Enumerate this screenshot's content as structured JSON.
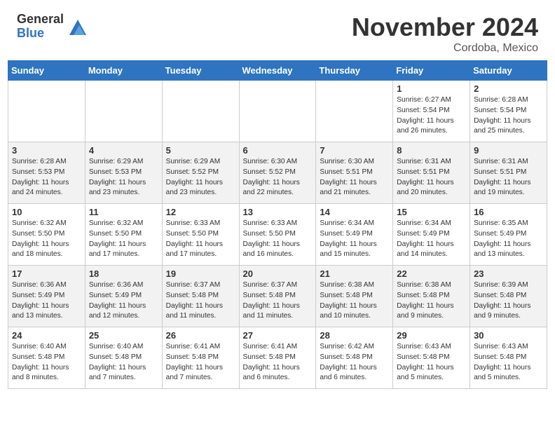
{
  "header": {
    "logo_general": "General",
    "logo_blue": "Blue",
    "month_title": "November 2024",
    "location": "Cordoba, Mexico"
  },
  "days_of_week": [
    "Sunday",
    "Monday",
    "Tuesday",
    "Wednesday",
    "Thursday",
    "Friday",
    "Saturday"
  ],
  "weeks": [
    [
      {
        "day": "",
        "info": ""
      },
      {
        "day": "",
        "info": ""
      },
      {
        "day": "",
        "info": ""
      },
      {
        "day": "",
        "info": ""
      },
      {
        "day": "",
        "info": ""
      },
      {
        "day": "1",
        "info": "Sunrise: 6:27 AM\nSunset: 5:54 PM\nDaylight: 11 hours and 26 minutes."
      },
      {
        "day": "2",
        "info": "Sunrise: 6:28 AM\nSunset: 5:54 PM\nDaylight: 11 hours and 25 minutes."
      }
    ],
    [
      {
        "day": "3",
        "info": "Sunrise: 6:28 AM\nSunset: 5:53 PM\nDaylight: 11 hours and 24 minutes."
      },
      {
        "day": "4",
        "info": "Sunrise: 6:29 AM\nSunset: 5:53 PM\nDaylight: 11 hours and 23 minutes."
      },
      {
        "day": "5",
        "info": "Sunrise: 6:29 AM\nSunset: 5:52 PM\nDaylight: 11 hours and 23 minutes."
      },
      {
        "day": "6",
        "info": "Sunrise: 6:30 AM\nSunset: 5:52 PM\nDaylight: 11 hours and 22 minutes."
      },
      {
        "day": "7",
        "info": "Sunrise: 6:30 AM\nSunset: 5:51 PM\nDaylight: 11 hours and 21 minutes."
      },
      {
        "day": "8",
        "info": "Sunrise: 6:31 AM\nSunset: 5:51 PM\nDaylight: 11 hours and 20 minutes."
      },
      {
        "day": "9",
        "info": "Sunrise: 6:31 AM\nSunset: 5:51 PM\nDaylight: 11 hours and 19 minutes."
      }
    ],
    [
      {
        "day": "10",
        "info": "Sunrise: 6:32 AM\nSunset: 5:50 PM\nDaylight: 11 hours and 18 minutes."
      },
      {
        "day": "11",
        "info": "Sunrise: 6:32 AM\nSunset: 5:50 PM\nDaylight: 11 hours and 17 minutes."
      },
      {
        "day": "12",
        "info": "Sunrise: 6:33 AM\nSunset: 5:50 PM\nDaylight: 11 hours and 17 minutes."
      },
      {
        "day": "13",
        "info": "Sunrise: 6:33 AM\nSunset: 5:50 PM\nDaylight: 11 hours and 16 minutes."
      },
      {
        "day": "14",
        "info": "Sunrise: 6:34 AM\nSunset: 5:49 PM\nDaylight: 11 hours and 15 minutes."
      },
      {
        "day": "15",
        "info": "Sunrise: 6:34 AM\nSunset: 5:49 PM\nDaylight: 11 hours and 14 minutes."
      },
      {
        "day": "16",
        "info": "Sunrise: 6:35 AM\nSunset: 5:49 PM\nDaylight: 11 hours and 13 minutes."
      }
    ],
    [
      {
        "day": "17",
        "info": "Sunrise: 6:36 AM\nSunset: 5:49 PM\nDaylight: 11 hours and 13 minutes."
      },
      {
        "day": "18",
        "info": "Sunrise: 6:36 AM\nSunset: 5:49 PM\nDaylight: 11 hours and 12 minutes."
      },
      {
        "day": "19",
        "info": "Sunrise: 6:37 AM\nSunset: 5:48 PM\nDaylight: 11 hours and 11 minutes."
      },
      {
        "day": "20",
        "info": "Sunrise: 6:37 AM\nSunset: 5:48 PM\nDaylight: 11 hours and 11 minutes."
      },
      {
        "day": "21",
        "info": "Sunrise: 6:38 AM\nSunset: 5:48 PM\nDaylight: 11 hours and 10 minutes."
      },
      {
        "day": "22",
        "info": "Sunrise: 6:38 AM\nSunset: 5:48 PM\nDaylight: 11 hours and 9 minutes."
      },
      {
        "day": "23",
        "info": "Sunrise: 6:39 AM\nSunset: 5:48 PM\nDaylight: 11 hours and 9 minutes."
      }
    ],
    [
      {
        "day": "24",
        "info": "Sunrise: 6:40 AM\nSunset: 5:48 PM\nDaylight: 11 hours and 8 minutes."
      },
      {
        "day": "25",
        "info": "Sunrise: 6:40 AM\nSunset: 5:48 PM\nDaylight: 11 hours and 7 minutes."
      },
      {
        "day": "26",
        "info": "Sunrise: 6:41 AM\nSunset: 5:48 PM\nDaylight: 11 hours and 7 minutes."
      },
      {
        "day": "27",
        "info": "Sunrise: 6:41 AM\nSunset: 5:48 PM\nDaylight: 11 hours and 6 minutes."
      },
      {
        "day": "28",
        "info": "Sunrise: 6:42 AM\nSunset: 5:48 PM\nDaylight: 11 hours and 6 minutes."
      },
      {
        "day": "29",
        "info": "Sunrise: 6:43 AM\nSunset: 5:48 PM\nDaylight: 11 hours and 5 minutes."
      },
      {
        "day": "30",
        "info": "Sunrise: 6:43 AM\nSunset: 5:48 PM\nDaylight: 11 hours and 5 minutes."
      }
    ]
  ]
}
